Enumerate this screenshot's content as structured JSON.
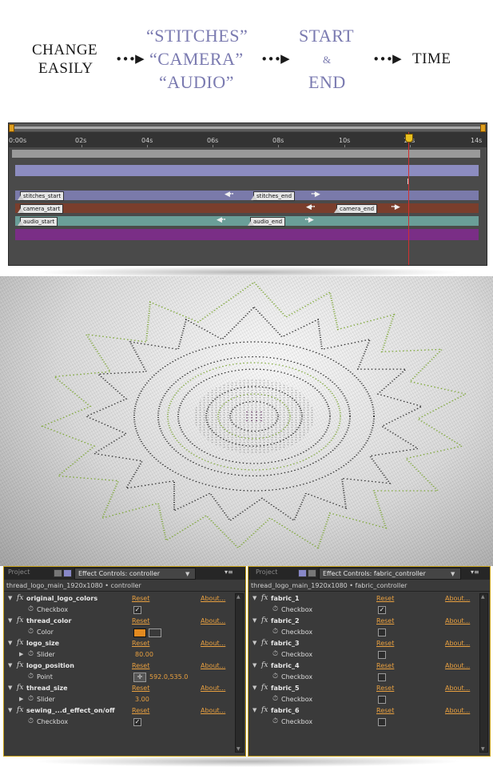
{
  "header": {
    "col1": [
      "CHANGE",
      "EASILY"
    ],
    "col2": [
      "“STITCHES”",
      "“CAMERA”",
      "“AUDIO”"
    ],
    "col3_top": "START",
    "col3_amp": "&",
    "col3_bottom": "END",
    "col4": "TIME",
    "arrow": "∙∙∙▶"
  },
  "timeline": {
    "ticks": [
      "0:00s",
      "02s",
      "04s",
      "06s",
      "08s",
      "10s",
      "12s",
      "14s"
    ],
    "markers": {
      "stitches_start": "stitches_start",
      "stitches_end": "stitches_end",
      "camera_start": "camera_start",
      "camera_end": "camera_end",
      "audio_start": "audio_start",
      "audio_end": "audio_end"
    },
    "arrow_left": "◀∙∙",
    "arrow_right": "∙∙▶",
    "cursor": "I"
  },
  "colors": {
    "track_lavender": "#8c8cc0",
    "track_stitches": "#7a7aaa",
    "track_camera": "#7a3e2c",
    "track_audio": "#6a9e98",
    "track_purple": "#7a2e86",
    "accent_orange": "#e8a040",
    "thread_color": "#e38a1f"
  },
  "panel_left": {
    "tab_project": "Project",
    "tab_effect": "Effect Controls: controller",
    "breadcrumb": "thread_logo_main_1920x1080 • controller",
    "effects": [
      {
        "name": "original_logo_colors",
        "reset": "Reset",
        "about": "About...",
        "param": "Checkbox",
        "kind": "checkbox",
        "value": "✓"
      },
      {
        "name": "thread_color",
        "reset": "Reset",
        "about": "About...",
        "param": "Color",
        "kind": "color",
        "value": ""
      },
      {
        "name": "logo_size",
        "reset": "Reset",
        "about": "About...",
        "param": "Slider",
        "kind": "slider",
        "value": "80.00"
      },
      {
        "name": "logo_position",
        "reset": "Reset",
        "about": "About...",
        "param": "Point",
        "kind": "point",
        "value": "592.0,535.0"
      },
      {
        "name": "thread_size",
        "reset": "Reset",
        "about": "About...",
        "param": "Slider",
        "kind": "slider",
        "value": "3.00"
      },
      {
        "name": "sewing_...d_effect_on/off",
        "reset": "Reset",
        "about": "About...",
        "param": "Checkbox",
        "kind": "checkbox",
        "value": "✓"
      }
    ]
  },
  "panel_right": {
    "tab_project": "Project",
    "tab_effect": "Effect Controls: fabric_controller",
    "breadcrumb": "thread_logo_main_1920x1080 • fabric_controller",
    "effects": [
      {
        "name": "fabric_1",
        "reset": "Reset",
        "about": "About...",
        "param": "Checkbox",
        "kind": "checkbox",
        "value": "✓"
      },
      {
        "name": "fabric_2",
        "reset": "Reset",
        "about": "About...",
        "param": "Checkbox",
        "kind": "checkbox",
        "value": ""
      },
      {
        "name": "fabric_3",
        "reset": "Reset",
        "about": "About...",
        "param": "Checkbox",
        "kind": "checkbox",
        "value": ""
      },
      {
        "name": "fabric_4",
        "reset": "Reset",
        "about": "About...",
        "param": "Checkbox",
        "kind": "checkbox",
        "value": ""
      },
      {
        "name": "fabric_5",
        "reset": "Reset",
        "about": "About...",
        "param": "Checkbox",
        "kind": "checkbox",
        "value": ""
      },
      {
        "name": "fabric_6",
        "reset": "Reset",
        "about": "About...",
        "param": "Checkbox",
        "kind": "checkbox",
        "value": ""
      }
    ]
  }
}
